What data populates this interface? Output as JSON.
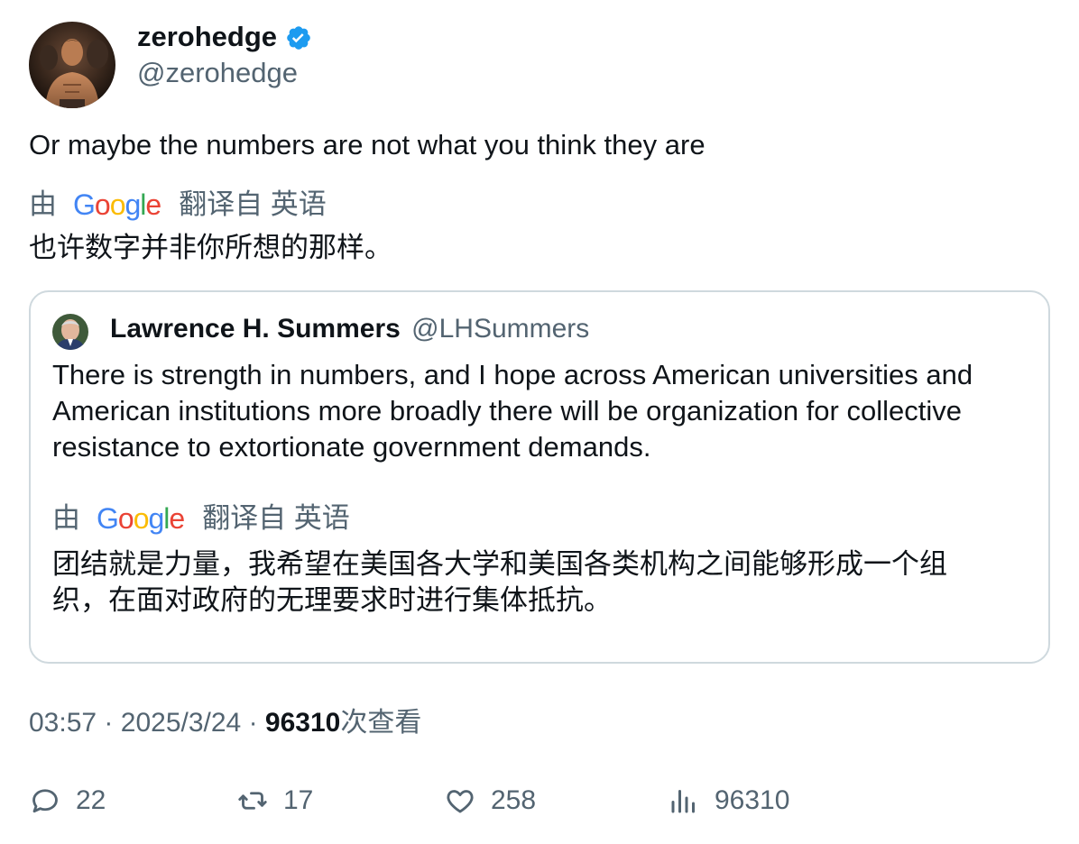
{
  "tweet": {
    "author": {
      "name": "zerohedge",
      "handle": "@zerohedge",
      "verified": true
    },
    "text": "Or maybe the numbers are not what you think they are",
    "translation": {
      "by": "由",
      "provider": "Google",
      "source_lang": "翻译自 英语",
      "text": "也许数字并非你所想的那样。"
    }
  },
  "quote": {
    "author": {
      "name": "Lawrence H. Summers",
      "handle": "@LHSummers"
    },
    "text": "There is strength in numbers, and I hope across American universities and American institutions more broadly there will be organization for collective resistance to extortionate government demands.",
    "translation": {
      "by": "由",
      "provider": "Google",
      "source_lang": "翻译自 英语",
      "text": "团结就是力量，我希望在美国各大学和美国各类机构之间能够形成一个组织，在面对政府的无理要求时进行集体抵抗。"
    }
  },
  "meta": {
    "time": "03:57",
    "separator": "·",
    "date": "2025/3/24",
    "views_count": "96310",
    "views_label": "次查看"
  },
  "actions": {
    "replies": "22",
    "retweets": "17",
    "likes": "258",
    "views": "96310"
  },
  "colors": {
    "verified_blue": "#1d9bf0",
    "secondary_text": "#536471",
    "primary_text": "#0f1419",
    "border": "#cfd9de"
  },
  "icons": [
    "verified-badge-icon",
    "reply-icon",
    "retweet-icon",
    "like-icon",
    "views-icon"
  ]
}
